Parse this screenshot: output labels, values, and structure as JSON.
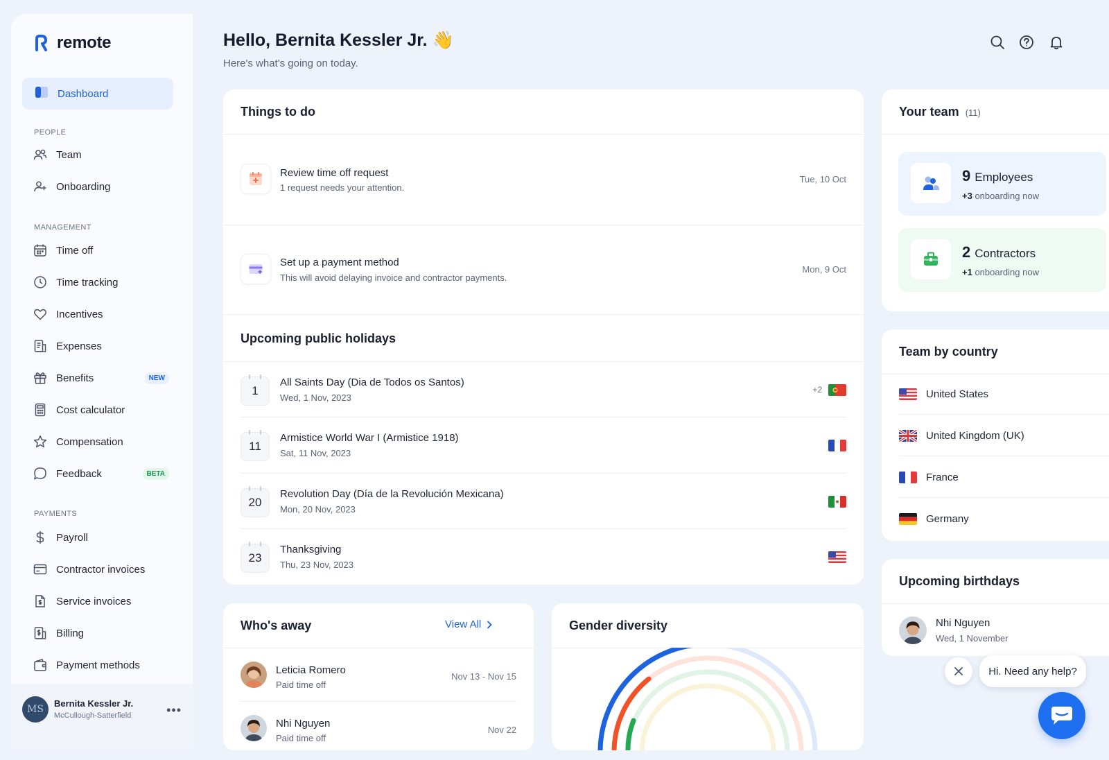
{
  "app": {
    "name": "remote",
    "brand_color": "#1d63e0"
  },
  "sidebar": {
    "dashboard_label": "Dashboard",
    "sections": {
      "people": "PEOPLE",
      "management": "MANAGEMENT",
      "payments": "PAYMENTS"
    },
    "people_items": [
      {
        "label": "Team",
        "icon": "users-icon"
      },
      {
        "label": "Onboarding",
        "icon": "user-plus-icon"
      }
    ],
    "management_items": [
      {
        "label": "Time off",
        "icon": "calendar-icon"
      },
      {
        "label": "Time tracking",
        "icon": "clock-icon"
      },
      {
        "label": "Incentives",
        "icon": "heart-icon"
      },
      {
        "label": "Expenses",
        "icon": "receipt-icon"
      },
      {
        "label": "Benefits",
        "icon": "gift-icon",
        "badge": "NEW"
      },
      {
        "label": "Cost calculator",
        "icon": "calculator-icon"
      },
      {
        "label": "Compensation",
        "icon": "star-icon"
      },
      {
        "label": "Feedback",
        "icon": "chat-icon",
        "badge": "BETA"
      }
    ],
    "payments_items": [
      {
        "label": "Payroll",
        "icon": "dollar-icon"
      },
      {
        "label": "Contractor invoices",
        "icon": "card-icon"
      },
      {
        "label": "Service invoices",
        "icon": "invoice-icon"
      },
      {
        "label": "Billing",
        "icon": "billing-icon"
      },
      {
        "label": "Payment methods",
        "icon": "wallet-icon"
      }
    ],
    "user": {
      "initials": "MS",
      "name": "Bernita Kessler Jr.",
      "org": "McCullough-Satterfield",
      "more": "•••"
    }
  },
  "header": {
    "greeting": "Hello, Bernita Kessler Jr. 👋",
    "subtitle": "Here's what's going on today."
  },
  "todo": {
    "title": "Things to do",
    "items": [
      {
        "title": "Review time off request",
        "desc": "1 request needs your attention.",
        "date": "Tue, 10 Oct"
      },
      {
        "title": "Set up a payment method",
        "desc": "This will avoid delaying invoice and contractor payments.",
        "date": "Mon, 9 Oct"
      }
    ]
  },
  "holidays": {
    "title": "Upcoming public holidays",
    "items": [
      {
        "day": "1",
        "name": "All Saints Day (Dia de Todos os Santos)",
        "date": "Wed, 1 Nov, 2023",
        "more": "+2",
        "flag": "PT"
      },
      {
        "day": "11",
        "name": "Armistice World War I (Armistice 1918)",
        "date": "Sat, 11 Nov, 2023",
        "flag": "FR"
      },
      {
        "day": "20",
        "name": "Revolution Day (Día de la Revolución Mexicana)",
        "date": "Mon, 20 Nov, 2023",
        "flag": "MX"
      },
      {
        "day": "23",
        "name": "Thanksgiving",
        "date": "Thu, 23 Nov, 2023",
        "flag": "US"
      }
    ]
  },
  "team": {
    "title": "Your team",
    "count": "(11)",
    "employees": {
      "number": "9",
      "label": "Employees",
      "onboarding_num": "+3",
      "onboarding_label": "onboarding now"
    },
    "contractors": {
      "number": "2",
      "label": "Contractors",
      "onboarding_num": "+1",
      "onboarding_label": "onboarding now"
    }
  },
  "countries": {
    "title": "Team by country",
    "items": [
      "United States",
      "United Kingdom (UK)",
      "France",
      "Germany"
    ]
  },
  "birthdays": {
    "title": "Upcoming birthdays",
    "items": [
      {
        "name": "Nhi Nguyen",
        "date": "Wed, 1 November"
      }
    ]
  },
  "away": {
    "title": "Who's away",
    "view_all": "View All",
    "items": [
      {
        "name": "Leticia Romero",
        "type": "Paid time off",
        "dates": "Nov 13 - Nov 15"
      },
      {
        "name": "Nhi Nguyen",
        "type": "Paid time off",
        "dates": "Nov 22"
      }
    ]
  },
  "gender": {
    "title": "Gender diversity"
  },
  "help": {
    "text": "Hi. Need any help?"
  }
}
